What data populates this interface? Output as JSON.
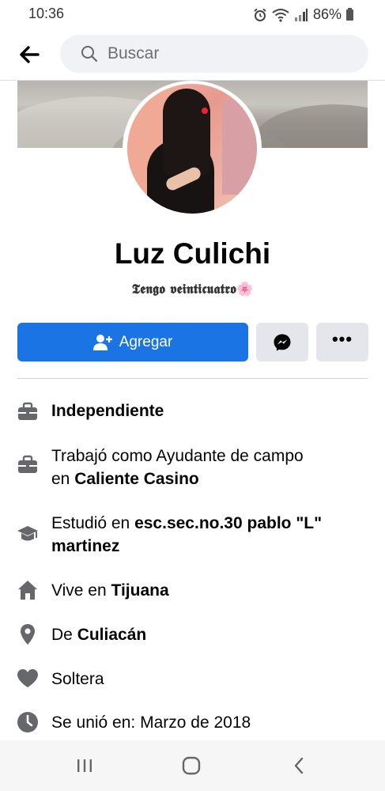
{
  "status_bar": {
    "time": "10:36",
    "battery_text": "86%",
    "icons": [
      "alarm-icon",
      "wifi-icon",
      "signal-icon",
      "battery-icon"
    ]
  },
  "top_nav": {
    "back_icon": "arrow-left-icon",
    "search": {
      "placeholder": "Buscar",
      "value": ""
    }
  },
  "profile": {
    "name": "Luz Culichi",
    "bio": "𝕿𝖊𝖓𝖌𝖔 𝖛𝖊𝖎𝖓𝖙𝖎𝖈𝖚𝖆𝖙𝖗𝖔🌸"
  },
  "actions": {
    "add_label": "Agregar",
    "add_icon": "add-friend-icon",
    "message_icon": "messenger-icon",
    "more_label": "•••"
  },
  "info": [
    {
      "icon": "briefcase-icon",
      "prefix": "",
      "bold": "Independiente",
      "rest": ""
    },
    {
      "icon": "briefcase-icon",
      "prefix": "Trabajó como Ayudante de campo en ",
      "bold": "Caliente Casino",
      "rest": ""
    },
    {
      "icon": "graduation-cap-icon",
      "prefix": "Estudió en ",
      "bold": "esc.sec.no.30 pablo \"L\" martinez",
      "rest": ""
    },
    {
      "icon": "home-icon",
      "prefix": "Vive en ",
      "bold": "Tijuana",
      "rest": ""
    },
    {
      "icon": "location-pin-icon",
      "prefix": "De ",
      "bold": "Culiacán",
      "rest": ""
    },
    {
      "icon": "heart-icon",
      "prefix": "Soltera",
      "bold": "",
      "rest": ""
    },
    {
      "icon": "clock-icon",
      "prefix": "Se unió en: Marzo de 2018",
      "bold": "",
      "rest": ""
    }
  ],
  "colors": {
    "primary": "#1b74e4",
    "secondary_button": "#e4e6eb",
    "icon_gray": "#65676b"
  },
  "system_nav": [
    "recent-apps-icon",
    "home-circle-icon",
    "back-chevron-icon"
  ]
}
